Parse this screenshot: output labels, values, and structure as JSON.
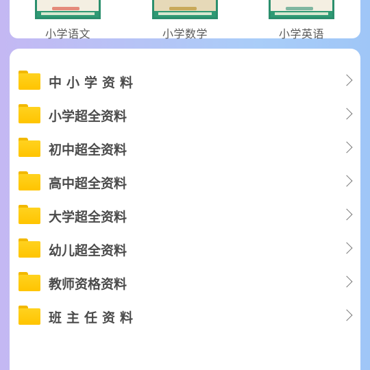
{
  "books": [
    {
      "label": "小学语文"
    },
    {
      "label": "小学数学"
    },
    {
      "label": "小学英语"
    }
  ],
  "folders": [
    {
      "label": "中小学资料",
      "icon": "folder-icon"
    },
    {
      "label": "小学超全资料",
      "icon": "folder-icon"
    },
    {
      "label": "初中超全资料",
      "icon": "folder-icon"
    },
    {
      "label": "高中超全资料",
      "icon": "folder-icon"
    },
    {
      "label": "大学超全资料",
      "icon": "folder-icon"
    },
    {
      "label": "幼儿超全资料",
      "icon": "folder-icon"
    },
    {
      "label": "教师资格资料",
      "icon": "folder-icon"
    },
    {
      "label": "班主任资料",
      "icon": "folder-icon"
    }
  ],
  "colors": {
    "folder": "#ffc400",
    "text": "#4a4a4a",
    "chevron": "#7a7a7a"
  }
}
